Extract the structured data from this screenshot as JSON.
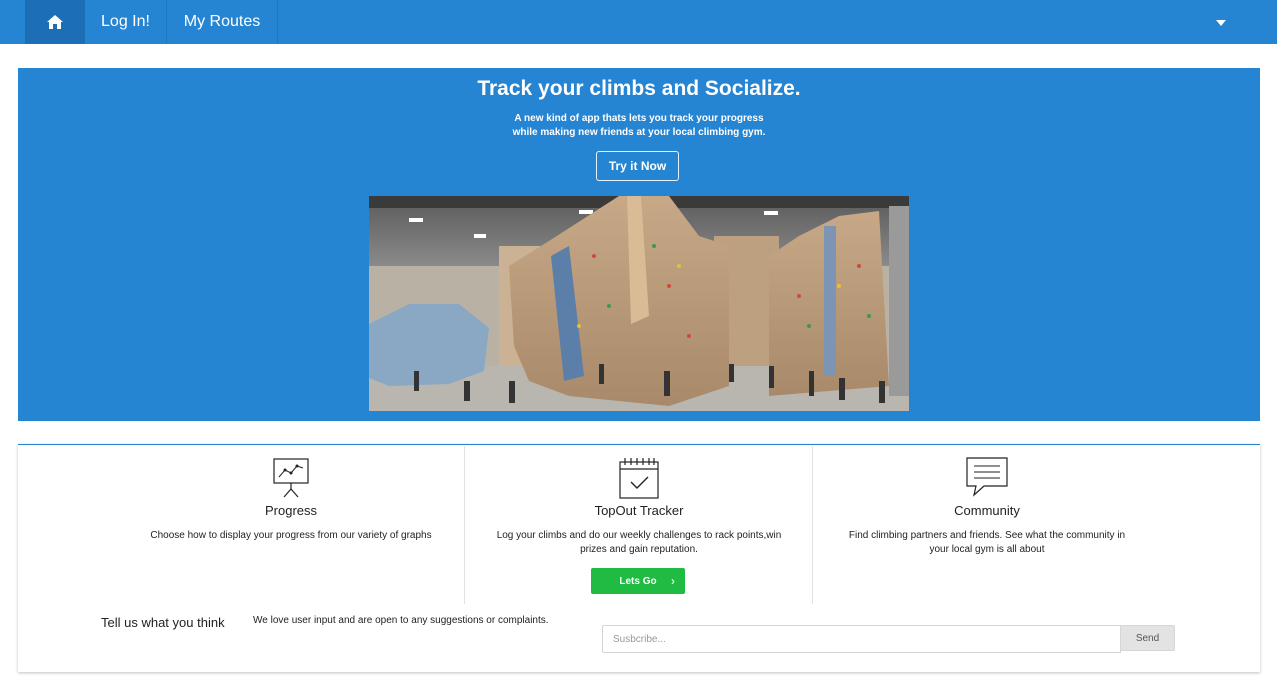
{
  "nav": {
    "home_icon": "home-icon",
    "login_label": "Log In!",
    "routes_label": "My Routes",
    "dropdown_icon": "caret-down-icon"
  },
  "hero": {
    "title": "Track your climbs and Socialize.",
    "subtitle_line1": "A new kind of app thats lets you track your progress",
    "subtitle_line2": "while making new friends at your local climbing gym.",
    "cta_label": "Try it Now",
    "image_icon": "climbing-gym-panorama"
  },
  "features": [
    {
      "icon": "presentation-chart-icon",
      "title": "Progress",
      "description": "Choose how to display your progress from our variety of graphs"
    },
    {
      "icon": "calendar-check-icon",
      "title": "TopOut Tracker",
      "description_line1": "Log your climbs and do our weekly challenges to rack points,win",
      "description_line2": "prizes and gain reputation.",
      "button_label": "Lets Go"
    },
    {
      "icon": "speech-bubble-icon",
      "title": "Community",
      "description_line1": "Find climbing partners and friends. See what the community in",
      "description_line2": "your local gym is all about"
    }
  ],
  "feedback": {
    "title": "Tell us what you think",
    "text": "We love user input and are open to any suggestions or complaints.",
    "input_placeholder": "Susbcribe...",
    "send_label": "Send"
  },
  "colors": {
    "brand_blue": "#2585d2",
    "nav_active": "#1c6fb4",
    "cta_green": "#1fbb42"
  }
}
